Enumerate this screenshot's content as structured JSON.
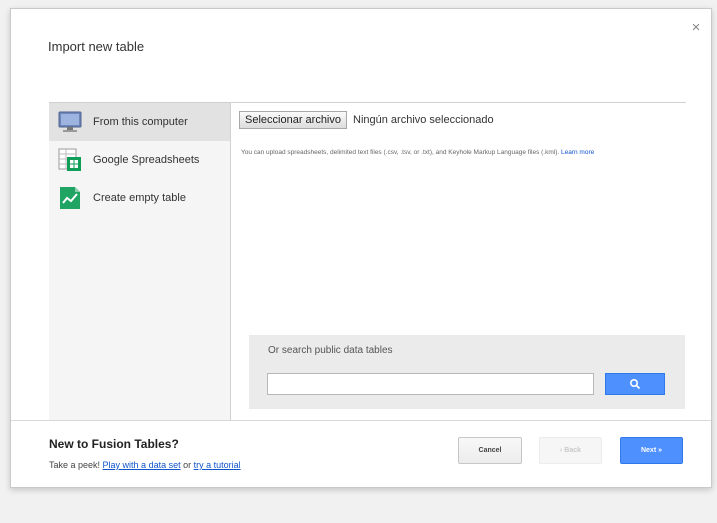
{
  "dialog": {
    "title": "Import new table",
    "close_symbol": "×",
    "close_icon": "close-icon"
  },
  "sidebar": {
    "items": [
      {
        "label": "From this computer",
        "icon": "computer-icon",
        "active": true
      },
      {
        "label": "Google Spreadsheets",
        "icon": "spreadsheet-icon",
        "active": false
      },
      {
        "label": "Create empty table",
        "icon": "chart-table-icon",
        "active": false
      }
    ]
  },
  "upload": {
    "button_label": "Seleccionar archivo",
    "status": "Ningún archivo seleccionado",
    "hint_text": "You can upload spreadsheets, delimited text files (.csv, .tsv, or .txt), and Keyhole Markup Language files (.kml).",
    "learn_more": "Learn more"
  },
  "search": {
    "label": "Or search public data tables",
    "placeholder": "",
    "value": "",
    "button_icon": "search-icon"
  },
  "footer": {
    "heading": "New to Fusion Tables?",
    "prefix": "Take a peek! ",
    "link1": "Play with a data set",
    "middle": " or ",
    "link2": "try a tutorial"
  },
  "buttons": {
    "cancel": "Cancel",
    "back": "‹ Back",
    "next": "Next »"
  },
  "colors": {
    "primary": "#4d90fe",
    "link": "#1155cc",
    "spreadsheet_green": "#0f9d58"
  }
}
